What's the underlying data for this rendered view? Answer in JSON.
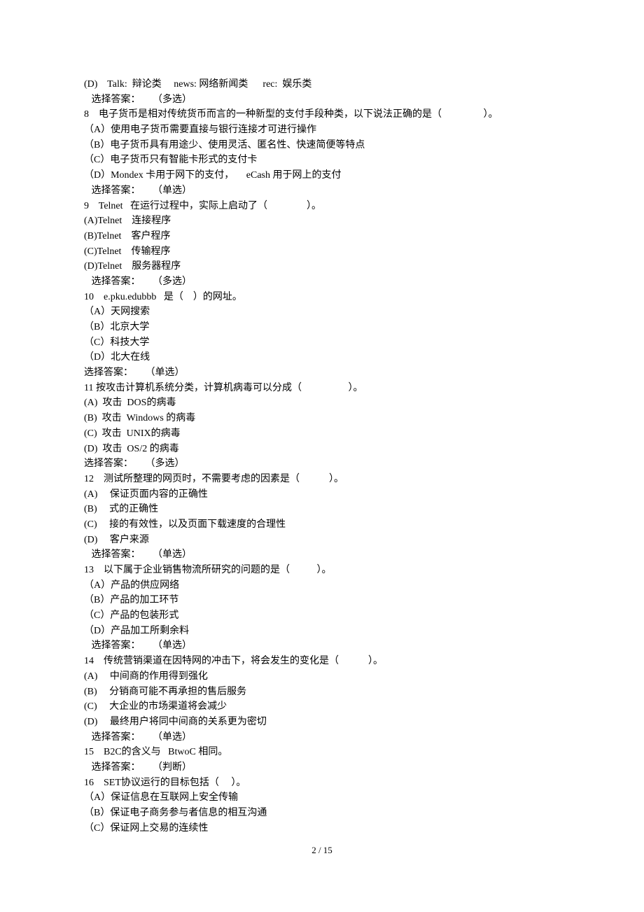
{
  "lines": [
    "(D)    Talk:  辩论类     news: 网络新闻类      rec:  娱乐类",
    "   选择答案：     （多选）",
    "8    电子货币是相对传统货币而言的一种新型的支付手段种类，以下说法正确的是（                 ）。",
    "（A）使用电子货币需要直接与银行连接才可进行操作",
    "（B）电子货币具有用途少、使用灵活、匿名性、快速简便等特点",
    "（C）电子货币只有智能卡形式的支付卡",
    "（D）Mondex 卡用于网下的支付，     eCash 用于网上的支付",
    "   选择答案：     （单选）",
    "9    Telnet   在运行过程中，实际上启动了（                ）。",
    "(A)Telnet    连接程序",
    "(B)Telnet    客户程序",
    "(C)Telnet    传输程序",
    "(D)Telnet    服务器程序",
    "   选择答案：     （多选）",
    "10    e.pku.edubbb   是（    ）的网址。",
    "（A）天网搜索",
    "（B）北京大学",
    "（C）科技大学",
    "（D）北大在线",
    "选择答案：     （单选）",
    "11 按攻击计算机系统分类，计算机病毒可以分成（                   ）。",
    "(A)  攻击  DOS的病毒",
    "(B)  攻击  Windows 的病毒",
    "(C)  攻击  UNIX的病毒",
    "(D)  攻击  OS/2 的病毒",
    "选择答案：     （多选）",
    "12    测试所整理的网页时，不需要考虑的因素是（            ）。",
    "(A)     保证页面内容的正确性",
    "(B)     式的正确性",
    "(C)     接的有效性，以及页面下载速度的合理性",
    "(D)     客户来源",
    "   选择答案：     （单选）",
    "13    以下属于企业销售物流所研究的问题的是（           ）。",
    "（A）产品的供应网络",
    "（B）产品的加工环节",
    "（C）产品的包装形式",
    "（D）产品加工所剩余料",
    "   选择答案：     （单选）",
    "14    传统营销渠道在因特网的冲击下，将会发生的变化是（            ）。",
    "(A)     中间商的作用得到强化",
    "(B)     分销商可能不再承担的售后服务",
    "(C)     大企业的市场渠道将会减少",
    "(D)     最终用户将同中间商的关系更为密切",
    "   选择答案：     （单选）",
    "15    B2C的含义与   BtwoC 相同。",
    "   选择答案：     （判断）",
    "16    SET协议运行的目标包括（     ）。",
    "（A）保证信息在互联网上安全传输",
    "（B）保证电子商务参与者信息的相互沟通",
    "（C）保证网上交易的连续性"
  ],
  "footer": "2  /  15"
}
